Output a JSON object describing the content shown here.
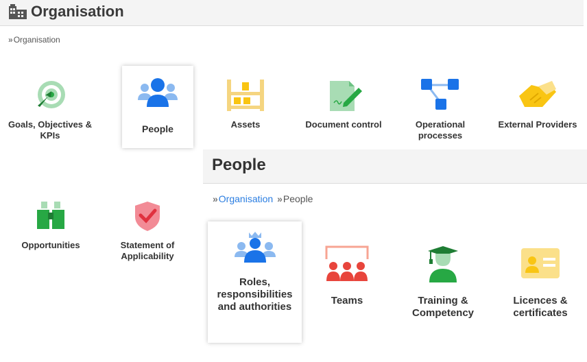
{
  "header": {
    "title": "Organisation",
    "icon": "building-icon"
  },
  "breadcrumb": {
    "separator": "»",
    "items": [
      "Organisation"
    ]
  },
  "tiles": [
    {
      "label": "Goals, Objectives & KPIs",
      "icon": "target-icon"
    },
    {
      "label": "People",
      "icon": "people-icon"
    },
    {
      "label": "Assets",
      "icon": "shelf-icon"
    },
    {
      "label": "Document control",
      "icon": "document-pen-icon"
    },
    {
      "label": "Operational processes",
      "icon": "process-flow-icon"
    },
    {
      "label": "External Providers",
      "icon": "handshake-icon"
    },
    {
      "label": "Opportunities",
      "icon": "binoculars-icon"
    },
    {
      "label": "Statement of Applicability",
      "icon": "shield-check-icon"
    }
  ],
  "people_panel": {
    "title": "People",
    "breadcrumb": {
      "separator": "»",
      "link": "Organisation",
      "current": "People"
    },
    "tiles": [
      {
        "label": "Roles, responsibilities and authorities",
        "icon": "role-crown-icon"
      },
      {
        "label": "Teams",
        "icon": "team-icon"
      },
      {
        "label": "Training & Competency",
        "icon": "graduate-icon"
      },
      {
        "label": "Licences & certificates",
        "icon": "id-card-icon"
      }
    ]
  },
  "colors": {
    "blue": "#1a73e8",
    "green": "#27a844",
    "yellow": "#f9c513",
    "red": "#e8453c",
    "pink": "#f28b96"
  }
}
